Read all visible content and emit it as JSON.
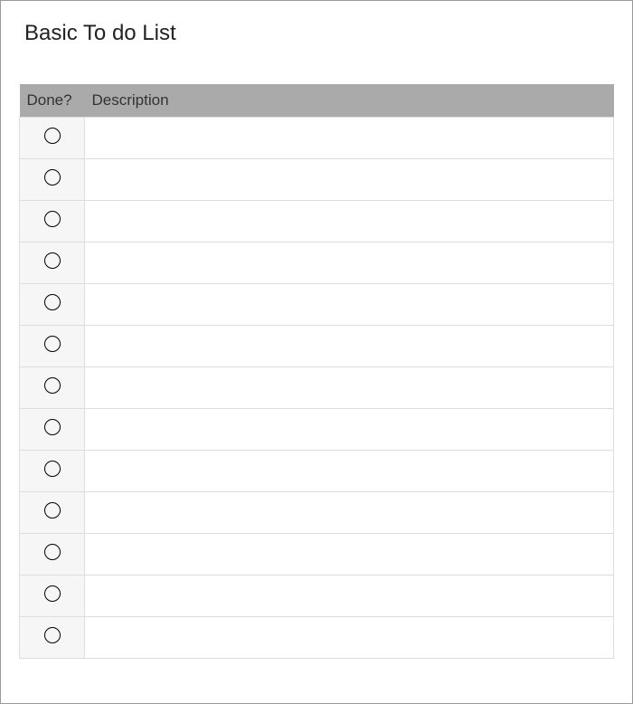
{
  "title": "Basic To do List",
  "headers": {
    "done": "Done?",
    "description": "Description"
  },
  "rows": [
    {
      "done": false,
      "description": ""
    },
    {
      "done": false,
      "description": ""
    },
    {
      "done": false,
      "description": ""
    },
    {
      "done": false,
      "description": ""
    },
    {
      "done": false,
      "description": ""
    },
    {
      "done": false,
      "description": ""
    },
    {
      "done": false,
      "description": ""
    },
    {
      "done": false,
      "description": ""
    },
    {
      "done": false,
      "description": ""
    },
    {
      "done": false,
      "description": ""
    },
    {
      "done": false,
      "description": ""
    },
    {
      "done": false,
      "description": ""
    },
    {
      "done": false,
      "description": ""
    }
  ]
}
